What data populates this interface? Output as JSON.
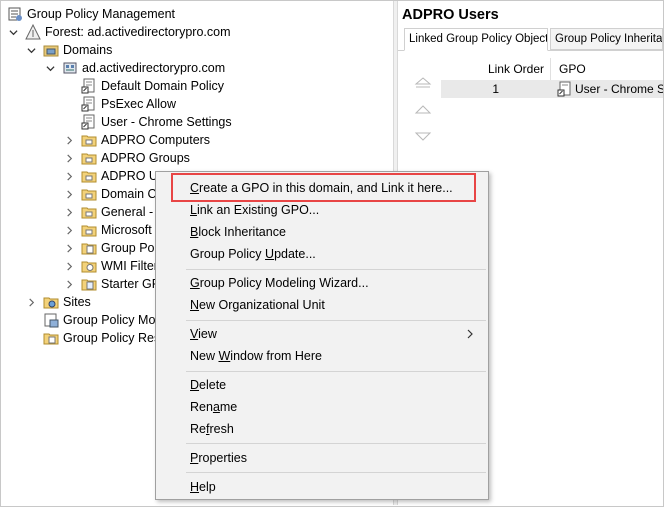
{
  "tree": {
    "root_label": "Group Policy Management",
    "forest_label": "Forest: ad.activedirectorypro.com",
    "domains_label": "Domains",
    "domain_label": "ad.activedirectorypro.com",
    "items": [
      {
        "label": "Default Domain Policy",
        "kind": "gpo-link"
      },
      {
        "label": "PsExec Allow",
        "kind": "gpo-link"
      },
      {
        "label": "User - Chrome Settings",
        "kind": "gpo-link"
      },
      {
        "label": "ADPRO Computers",
        "kind": "ou"
      },
      {
        "label": "ADPRO Groups",
        "kind": "ou"
      },
      {
        "label": "ADPRO Us",
        "kind": "ou"
      },
      {
        "label": "Domain C",
        "kind": "ou"
      },
      {
        "label": "General - ,",
        "kind": "ou"
      },
      {
        "label": "Microsoft",
        "kind": "ou"
      },
      {
        "label": "Group Poli",
        "kind": "folder"
      },
      {
        "label": "WMI Filter",
        "kind": "folder"
      },
      {
        "label": "Starter GP",
        "kind": "folder"
      }
    ],
    "sites_label": "Sites",
    "modeling_label": "Group Policy Mo",
    "results_label": "Group Policy Res"
  },
  "right_pane": {
    "title": "ADPRO Users",
    "tabs": [
      "Linked Group Policy Objects",
      "Group Policy Inheritance"
    ],
    "columns": [
      "Link Order",
      "GPO"
    ],
    "rows": [
      {
        "link_order": "1",
        "gpo": "User - Chrome Settings"
      }
    ]
  },
  "context_menu": {
    "items": [
      {
        "pre": "",
        "key": "C",
        "post": "reate a GPO in this domain, and Link it here..."
      },
      {
        "pre": "",
        "key": "L",
        "post": "ink an Existing GPO..."
      },
      {
        "pre": "",
        "key": "B",
        "post": "lock Inheritance"
      },
      {
        "pre": "Group Policy ",
        "key": "U",
        "post": "pdate..."
      },
      {
        "pre": "",
        "key": "G",
        "post": "roup Policy Modeling Wizard..."
      },
      {
        "pre": "",
        "key": "N",
        "post": "ew Organizational Unit"
      },
      {
        "pre": "",
        "key": "V",
        "post": "iew"
      },
      {
        "pre": "New ",
        "key": "W",
        "post": "indow from Here"
      },
      {
        "pre": "",
        "key": "D",
        "post": "elete"
      },
      {
        "pre": "Ren",
        "key": "a",
        "post": "me"
      },
      {
        "pre": "Re",
        "key": "f",
        "post": "resh"
      },
      {
        "pre": "",
        "key": "P",
        "post": "roperties"
      },
      {
        "pre": "",
        "key": "H",
        "post": "elp"
      }
    ]
  },
  "colors": {
    "highlight_border": "#e84545",
    "menu_background": "#f2f2f2",
    "selected_row": "#e9e9e9"
  }
}
